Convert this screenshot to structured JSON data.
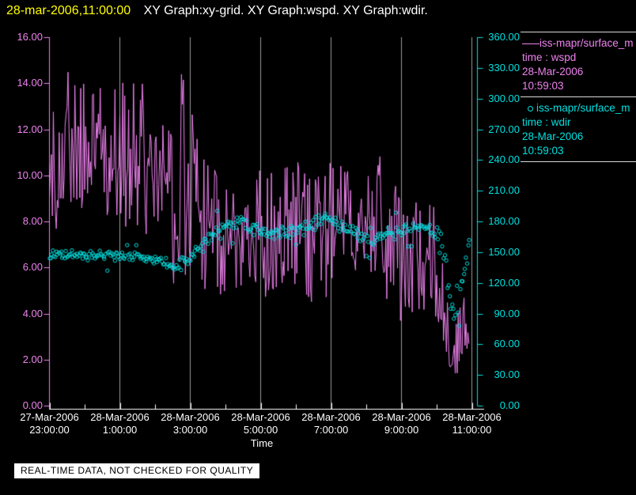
{
  "title": {
    "timestamp": "28-mar-2006,11:00:00",
    "graphs": "XY Graph:xy-grid.  XY Graph:wspd.  XY Graph:wdir."
  },
  "colors": {
    "background": "#000000",
    "wspd": "#ee82ee",
    "wdir": "#00e0e0",
    "x_axis": "#ffffff",
    "grid": "#9a9a9a",
    "title_time": "#ffff00",
    "title_text": "#ffffff",
    "legend_separator": "#d9d9d9"
  },
  "legend": {
    "entries": [
      {
        "series": "wspd",
        "marker": "line",
        "name": "iss-mapr/surface_m",
        "time_label": "time : wspd",
        "date": "28-Mar-2006",
        "time": "10:59:03"
      },
      {
        "series": "wdir",
        "marker": "open-circle",
        "name": "iss-mapr/surface_m",
        "time_label": "time : wdir",
        "date": "28-Mar-2006",
        "time": "10:59:03"
      }
    ]
  },
  "footer": {
    "notice": "REAL-TIME DATA, NOT CHECKED FOR QUALITY"
  },
  "chart_data": {
    "type": "line+scatter",
    "x_axis": {
      "label": "Time",
      "hours_total": 12,
      "major_tick_every_hours": 2,
      "minor_tick_every_hours": 1,
      "ticks": [
        {
          "date": "27-Mar-2006",
          "time": "23:00:00"
        },
        {
          "date": "28-Mar-2006",
          "time": "1:00:00"
        },
        {
          "date": "28-Mar-2006",
          "time": "3:00:00"
        },
        {
          "date": "28-Mar-2006",
          "time": "5:00:00"
        },
        {
          "date": "28-Mar-2006",
          "time": "7:00:00"
        },
        {
          "date": "28-Mar-2006",
          "time": "9:00:00"
        },
        {
          "date": "28-Mar-2006",
          "time": "11:00:00"
        }
      ]
    },
    "y_left": {
      "series": "wspd",
      "min": 0,
      "max": 16,
      "step": 2,
      "tick_labels": [
        "16.00",
        "14.00",
        "12.00",
        "10.00",
        "8.00",
        "6.00",
        "4.00",
        "2.00",
        "0.00"
      ],
      "color": "#ee82ee"
    },
    "y_right": {
      "series": "wdir",
      "min": 0,
      "max": 360,
      "step": 30,
      "tick_labels": [
        "360.00",
        "330.00",
        "300.00",
        "270.00",
        "240.00",
        "210.00",
        "180.00",
        "150.00",
        "120.00",
        "90.00",
        "60.00",
        "30.00",
        "0.00"
      ],
      "color": "#00e0e0"
    },
    "grid": {
      "vertical_gridlines_every_hours": 2,
      "horizontal_gridlines": false,
      "color": "#9a9a9a"
    },
    "seed": 1337,
    "series": [
      {
        "name": "wspd",
        "type": "line",
        "color": "#ee82ee",
        "samples_per_hour": 36,
        "end_hour": 11.93,
        "trend_points_hour_value": [
          [
            0,
            10.6
          ],
          [
            0.6,
            11.4
          ],
          [
            1.5,
            11.0
          ],
          [
            2.3,
            10.4
          ],
          [
            3.0,
            10.8
          ],
          [
            3.45,
            9.2
          ],
          [
            3.8,
            10.2
          ],
          [
            4.15,
            9.0
          ],
          [
            4.5,
            7.8
          ],
          [
            5.0,
            7.0
          ],
          [
            5.6,
            7.6
          ],
          [
            6.2,
            7.8
          ],
          [
            6.9,
            8.0
          ],
          [
            7.4,
            7.4
          ],
          [
            8.0,
            8.3
          ],
          [
            8.8,
            8.6
          ],
          [
            9.4,
            8.0
          ],
          [
            10.0,
            6.9
          ],
          [
            10.5,
            6.3
          ],
          [
            10.9,
            6.7
          ],
          [
            11.2,
            4.5
          ],
          [
            11.45,
            1.9
          ],
          [
            11.7,
            3.3
          ],
          [
            11.93,
            4.1
          ]
        ],
        "spread_points_hour_value": [
          [
            0,
            2.6
          ],
          [
            0.6,
            2.8
          ],
          [
            1.5,
            3.0
          ],
          [
            2.3,
            3.0
          ],
          [
            3.0,
            2.8
          ],
          [
            3.45,
            3.0
          ],
          [
            3.8,
            4.0
          ],
          [
            4.15,
            3.6
          ],
          [
            4.5,
            3.0
          ],
          [
            5.0,
            2.4
          ],
          [
            5.6,
            2.6
          ],
          [
            6.2,
            2.8
          ],
          [
            6.9,
            2.8
          ],
          [
            7.4,
            3.0
          ],
          [
            8.0,
            2.6
          ],
          [
            8.8,
            2.2
          ],
          [
            9.4,
            2.4
          ],
          [
            10.0,
            2.6
          ],
          [
            10.5,
            2.4
          ],
          [
            10.9,
            2.2
          ],
          [
            11.2,
            1.8
          ],
          [
            11.45,
            1.3
          ],
          [
            11.7,
            1.3
          ],
          [
            11.93,
            1.5
          ]
        ]
      },
      {
        "name": "wdir",
        "type": "scatter",
        "color": "#00e0e0",
        "marker_radius": 2.2,
        "samples_per_hour": 30,
        "end_hour": 11.93,
        "trend_points_hour_value": [
          [
            0,
            148
          ],
          [
            1,
            147
          ],
          [
            2,
            146
          ],
          [
            3,
            144
          ],
          [
            3.5,
            136
          ],
          [
            3.8,
            140
          ],
          [
            4.3,
            156
          ],
          [
            4.9,
            172
          ],
          [
            5.4,
            182
          ],
          [
            5.9,
            172
          ],
          [
            6.4,
            168
          ],
          [
            7.0,
            171
          ],
          [
            7.6,
            179
          ],
          [
            7.9,
            184
          ],
          [
            8.5,
            172
          ],
          [
            9.1,
            160
          ],
          [
            9.6,
            168
          ],
          [
            10.1,
            172
          ],
          [
            10.6,
            178
          ],
          [
            10.9,
            171
          ],
          [
            11.15,
            158
          ],
          [
            11.3,
            118
          ],
          [
            11.45,
            86
          ],
          [
            11.6,
            97
          ],
          [
            11.75,
            130
          ],
          [
            11.93,
            164
          ]
        ],
        "spread_points_hour_value": [
          [
            0,
            5
          ],
          [
            3,
            6
          ],
          [
            3.8,
            7
          ],
          [
            4.9,
            8
          ],
          [
            5.4,
            9
          ],
          [
            6.4,
            7
          ],
          [
            7.9,
            8
          ],
          [
            9.1,
            7
          ],
          [
            10.6,
            7
          ],
          [
            11.0,
            9
          ],
          [
            11.3,
            17
          ],
          [
            11.45,
            12
          ],
          [
            11.6,
            10
          ],
          [
            11.93,
            6
          ]
        ]
      }
    ]
  }
}
